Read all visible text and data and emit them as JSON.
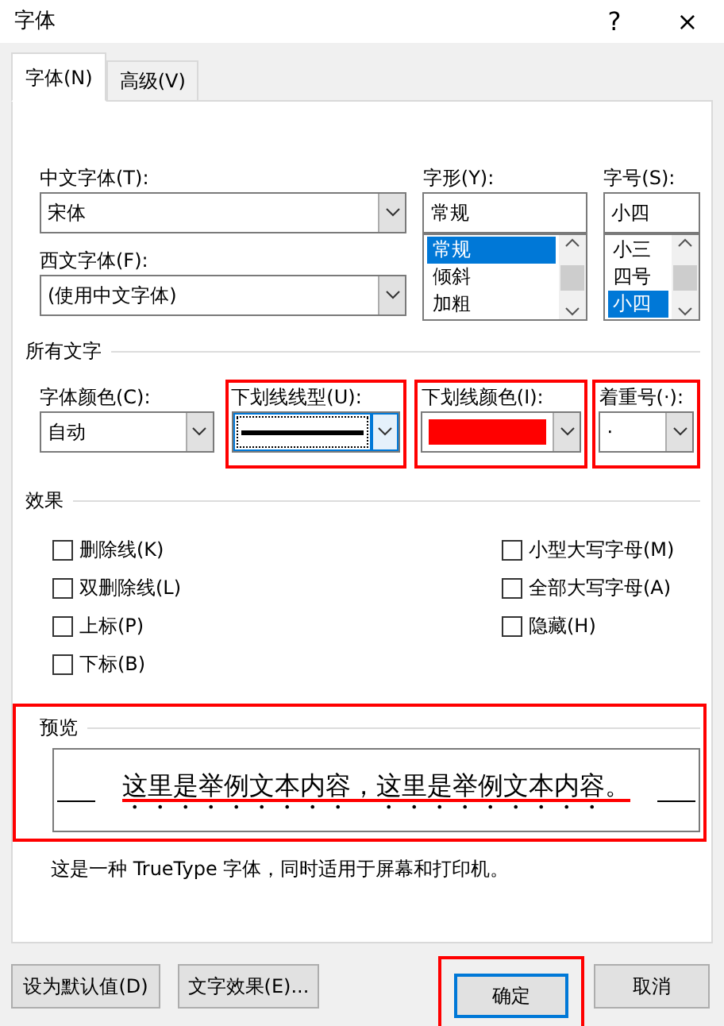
{
  "window": {
    "title": "字体",
    "help": "?",
    "close": "×"
  },
  "tabs": [
    {
      "label": "字体(N)",
      "selected": true
    },
    {
      "label": "高级(V)",
      "selected": false
    }
  ],
  "font": {
    "chinese_font": {
      "label": "中文字体(T):",
      "value": "宋体"
    },
    "western_font": {
      "label": "西文字体(F):",
      "value": "(使用中文字体)"
    },
    "style": {
      "label": "字形(Y):",
      "value": "常规",
      "options": [
        {
          "label": "常规",
          "selected": true
        },
        {
          "label": "倾斜",
          "selected": false
        },
        {
          "label": "加粗",
          "selected": false
        }
      ]
    },
    "size": {
      "label": "字号(S):",
      "value": "小四",
      "options": [
        {
          "label": "小三",
          "selected": false
        },
        {
          "label": "四号",
          "selected": false
        },
        {
          "label": "小四",
          "selected": true
        }
      ]
    }
  },
  "all_text": {
    "title": "所有文字",
    "fields": [
      {
        "kind": "select",
        "label": "字体颜色(C):",
        "value": "自动",
        "highlighted": false,
        "focused": false
      },
      {
        "kind": "line",
        "label": "下划线线型(U):",
        "highlighted": true,
        "focused": true
      },
      {
        "kind": "swatch",
        "label": "下划线颜色(I):",
        "color": "#ff0000",
        "highlighted": true,
        "focused": false
      },
      {
        "kind": "select",
        "label": "着重号(·):",
        "value": "·",
        "highlighted": true,
        "focused": false
      }
    ]
  },
  "effects": {
    "title": "效果",
    "options": [
      {
        "label": "删除线(K)",
        "checked": false
      },
      {
        "label": "小型大写字母(M)",
        "checked": false
      },
      {
        "label": "双删除线(L)",
        "checked": false
      },
      {
        "label": "全部大写字母(A)",
        "checked": false
      },
      {
        "label": "上标(P)",
        "checked": false
      },
      {
        "label": "隐藏(H)",
        "checked": false
      },
      {
        "label": "下标(B)",
        "checked": false
      }
    ]
  },
  "preview": {
    "title": "预览",
    "sample": "这里是举例文本内容，这里是举例文本内容。",
    "highlighted": true
  },
  "description": "这是一种 TrueType 字体，同时适用于屏幕和打印机。",
  "buttons": [
    {
      "label": "设为默认值(D)",
      "default": false,
      "highlighted": false
    },
    {
      "label": "文字效果(E)...",
      "default": false,
      "highlighted": false
    },
    {
      "label": "确定",
      "default": true,
      "highlighted": true
    },
    {
      "label": "取消",
      "default": false,
      "highlighted": false
    }
  ]
}
